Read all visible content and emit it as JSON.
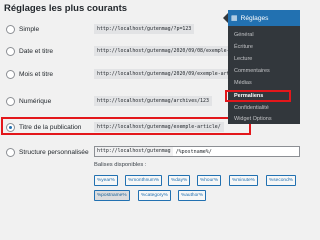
{
  "section": {
    "title": "Réglages les plus courants"
  },
  "options": [
    {
      "label": "Simple",
      "code": "http://localhost/gutenmag/?p=123",
      "checked": false
    },
    {
      "label": "Date et titre",
      "code": "http://localhost/gutenmag/2020/09/08/exemple-article/",
      "checked": false
    },
    {
      "label": "Mois et titre",
      "code": "http://localhost/gutenmag/2020/09/exemple-article/",
      "checked": false
    },
    {
      "label": "Numérique",
      "code": "http://localhost/gutenmag/archives/123",
      "checked": false
    },
    {
      "label": "Titre de la publication",
      "code": "http://localhost/gutenmag/exemple-article/",
      "checked": true
    },
    {
      "label": "Structure personnalisée",
      "prefix": "http://localhost/gutenmag",
      "value": "/%postname%/",
      "checked": false
    }
  ],
  "tags": {
    "label": "Balises disponibles :",
    "items": [
      "%year%",
      "%monthnum%",
      "%day%",
      "%hour%",
      "%minute%",
      "%second%",
      "%postname%",
      "%category%",
      "%author%"
    ],
    "active": "%postname%"
  },
  "admin_menu": {
    "header": "Réglages",
    "items": [
      "Général",
      "Écriture",
      "Lecture",
      "Commentaires",
      "Médias",
      "Permaliens",
      "Confidentialité",
      "Widget Options"
    ],
    "current": "Permaliens"
  },
  "colors": {
    "accent": "#2271b1",
    "highlight": "#e3171b",
    "menu_bg": "#32373c"
  }
}
